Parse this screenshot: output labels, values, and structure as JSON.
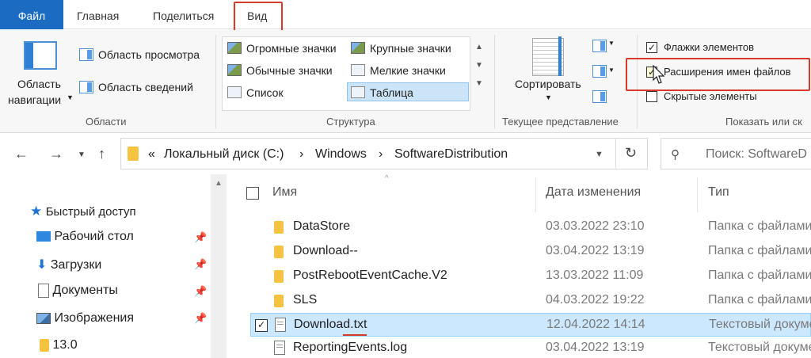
{
  "ribbon_tabs": {
    "file": "Файл",
    "home": "Главная",
    "share": "Поделиться",
    "view": "Вид"
  },
  "panes_group": {
    "nav_pane_line1": "Область",
    "nav_pane_line2": "навигации",
    "preview_pane": "Область просмотра",
    "details_pane": "Область сведений",
    "label": "Области"
  },
  "layout_group": {
    "items": [
      "Огромные значки",
      "Крупные значки",
      "Обычные значки",
      "Мелкие значки",
      "Список",
      "Таблица"
    ],
    "selected": "Таблица",
    "label": "Структура"
  },
  "current_view_group": {
    "sort_by": "Сортировать",
    "label": "Текущее представление"
  },
  "show_hide_group": {
    "item_checkboxes": {
      "label": "Флажки элементов",
      "checked": true
    },
    "file_name_extensions": {
      "label": "Расширения имен файлов",
      "checked": true
    },
    "hidden_items": {
      "label": "Скрытые элементы",
      "checked": false
    },
    "label": "Показать или ск"
  },
  "address": {
    "prefix": "«",
    "crumbs": [
      "Локальный диск (C:)",
      "Windows",
      "SoftwareDistribution"
    ],
    "separator": "›",
    "search_placeholder": "Поиск: SoftwareD"
  },
  "nav_pane": {
    "quick_access": "Быстрый доступ",
    "items": [
      {
        "label": "Рабочий стол",
        "icon": "desktop-icon",
        "pinned": true
      },
      {
        "label": "Загрузки",
        "icon": "downloads-icon",
        "pinned": true
      },
      {
        "label": "Документы",
        "icon": "documents-icon",
        "pinned": true
      },
      {
        "label": "Изображения",
        "icon": "pictures-icon",
        "pinned": true
      },
      {
        "label": "13.0",
        "icon": "folder-icon",
        "pinned": false
      }
    ]
  },
  "file_list": {
    "columns": {
      "name": "Имя",
      "date": "Дата изменения",
      "type": "Тип"
    },
    "rows": [
      {
        "name": "DataStore",
        "date": "03.03.2022 23:10",
        "type": "Папка с файлами",
        "kind": "folder",
        "selected": false
      },
      {
        "name": "Download--",
        "date": "03.04.2022 13:19",
        "type": "Папка с файлами",
        "kind": "folder",
        "selected": false
      },
      {
        "name": "PostRebootEventCache.V2",
        "date": "13.03.2022 11:09",
        "type": "Папка с файлами",
        "kind": "folder",
        "selected": false
      },
      {
        "name": "SLS",
        "date": "04.03.2022 19:22",
        "type": "Папка с файлами",
        "kind": "folder",
        "selected": false
      },
      {
        "name": "Download.txt",
        "date": "12.04.2022 14:14",
        "type": "Текстовый документ",
        "kind": "text",
        "selected": true
      },
      {
        "name": "ReportingEvents.log",
        "date": "03.04.2022 13:19",
        "type": "Текстовый документ",
        "kind": "text",
        "selected": false
      }
    ]
  },
  "colors": {
    "file_tab": "#1b6bc3",
    "highlight": "#d73a2a",
    "selection": "#cce8ff"
  }
}
